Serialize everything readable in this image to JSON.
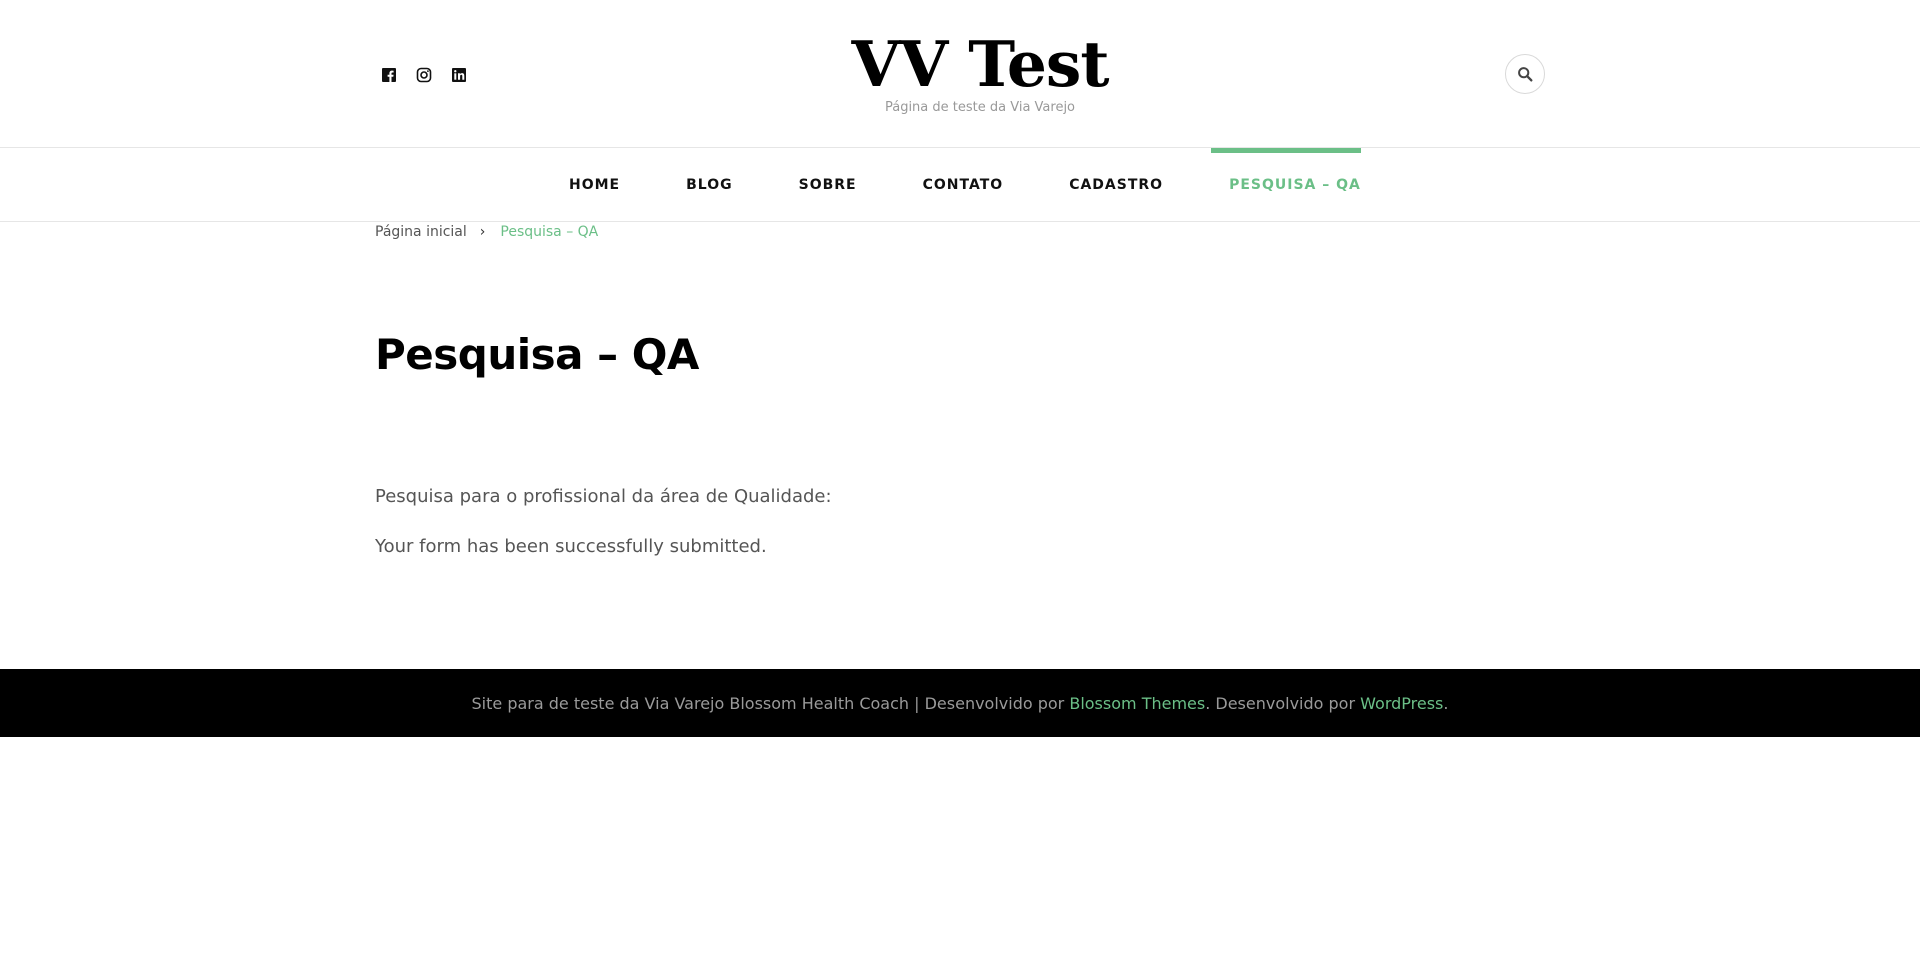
{
  "header": {
    "site_title": "VV Test",
    "site_description": "Página de teste da Via Varejo",
    "social": [
      "facebook-icon",
      "instagram-icon",
      "linkedin-icon"
    ],
    "search_icon": "search-icon"
  },
  "nav": {
    "items": [
      {
        "label": "HOME"
      },
      {
        "label": "BLOG"
      },
      {
        "label": "SOBRE"
      },
      {
        "label": "CONTATO"
      },
      {
        "label": "CADASTRO"
      },
      {
        "label": "PESQUISA – QA",
        "active": true
      }
    ]
  },
  "breadcrumb": {
    "home": "Página inicial",
    "separator": "›",
    "current": "Pesquisa – QA"
  },
  "page": {
    "title": "Pesquisa – QA",
    "paragraph1": "Pesquisa para o profissional da área de Qualidade:",
    "paragraph2": "Your form has been successfully submitted."
  },
  "footer": {
    "text1": "Site para de teste da Via Varejo Blossom Health Coach | Desenvolvido por ",
    "link1": "Blossom Themes",
    "text2": ". Desenvolvido por ",
    "link2": "WordPress",
    "text3": "."
  },
  "colors": {
    "accent": "#6bbf87",
    "footer_bg": "#000000"
  }
}
